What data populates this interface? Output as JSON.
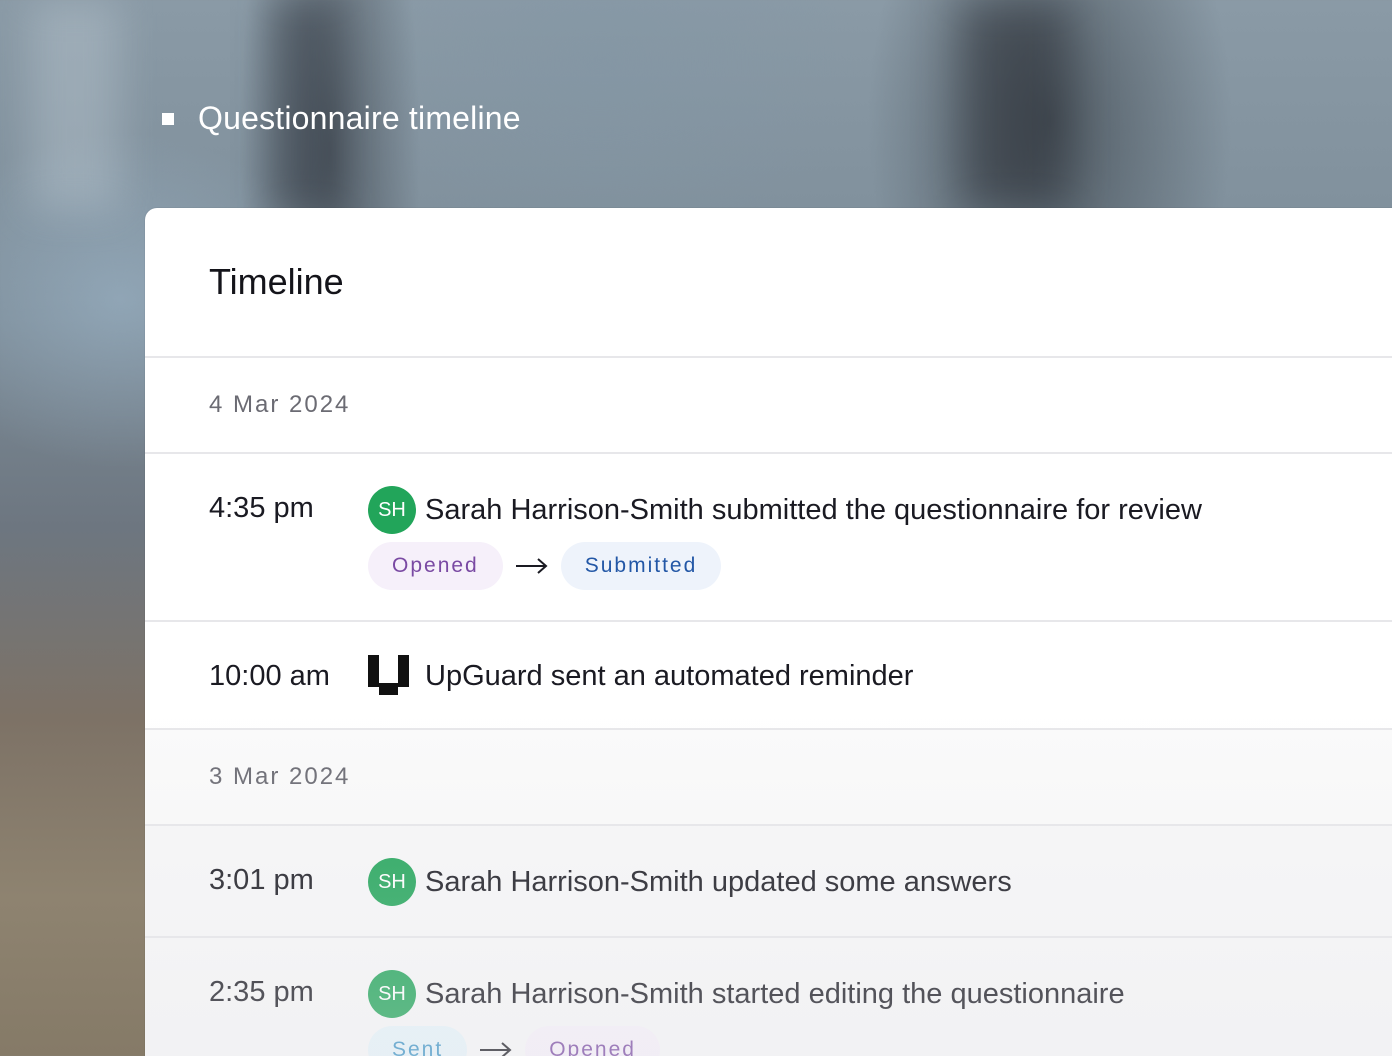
{
  "page": {
    "heading": "Questionnaire timeline"
  },
  "card": {
    "title": "Timeline"
  },
  "groups": [
    {
      "date": "4 Mar 2024",
      "events": [
        {
          "time": "4:35 pm",
          "actor_initials": "SH",
          "text": "Sarah Harrison-Smith submitted the questionnaire for review",
          "status_from": "Opened",
          "status_to": "Submitted"
        },
        {
          "time": "10:00 am",
          "actor_logo": "upguard-logo-icon",
          "text": "UpGuard sent an automated reminder"
        }
      ]
    },
    {
      "date": "3 Mar 2024",
      "events": [
        {
          "time": "3:01 pm",
          "actor_initials": "SH",
          "text": "Sarah Harrison-Smith updated some answers"
        },
        {
          "time": "2:35 pm",
          "actor_initials": "SH",
          "text": "Sarah Harrison-Smith started editing the questionnaire",
          "status_from": "Sent",
          "status_to": "Opened"
        }
      ]
    }
  ],
  "colors": {
    "avatar": "#22a55a",
    "opened_pill_text": "#7a4aa3",
    "submitted_pill_text": "#2357a6",
    "sent_pill_text": "#3b93c5"
  }
}
